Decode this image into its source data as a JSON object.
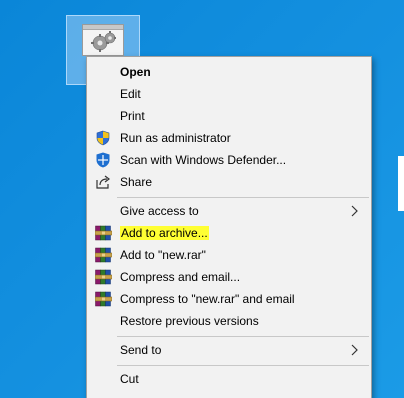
{
  "menu": {
    "items": [
      {
        "label": "Open",
        "icon": "",
        "bold": true
      },
      {
        "label": "Edit",
        "icon": ""
      },
      {
        "label": "Print",
        "icon": ""
      },
      {
        "label": "Run as administrator",
        "icon": "uac-shield-icon"
      },
      {
        "label": "Scan with Windows Defender...",
        "icon": "windows-defender-icon"
      },
      {
        "label": "Share",
        "icon": "share-icon"
      },
      {
        "label": "Give access to",
        "icon": "",
        "submenu": true
      },
      {
        "label": "Add to archive...",
        "icon": "winrar-icon",
        "highlighted": true
      },
      {
        "label": "Add to \"new.rar\"",
        "icon": "winrar-icon"
      },
      {
        "label": "Compress and email...",
        "icon": "winrar-icon"
      },
      {
        "label": "Compress to \"new.rar\" and email",
        "icon": "winrar-icon"
      },
      {
        "label": "Restore previous versions",
        "icon": ""
      },
      {
        "label": "Send to",
        "icon": "",
        "submenu": true
      },
      {
        "label": "Cut",
        "icon": ""
      }
    ]
  },
  "colors": {
    "desktop": "#0a86d8",
    "menu_bg": "#f2f2f2",
    "highlight": "#ffff33",
    "separator": "#c8c8c8"
  },
  "desktop_icon": {
    "icon": "gears-file-icon",
    "selected": true
  }
}
